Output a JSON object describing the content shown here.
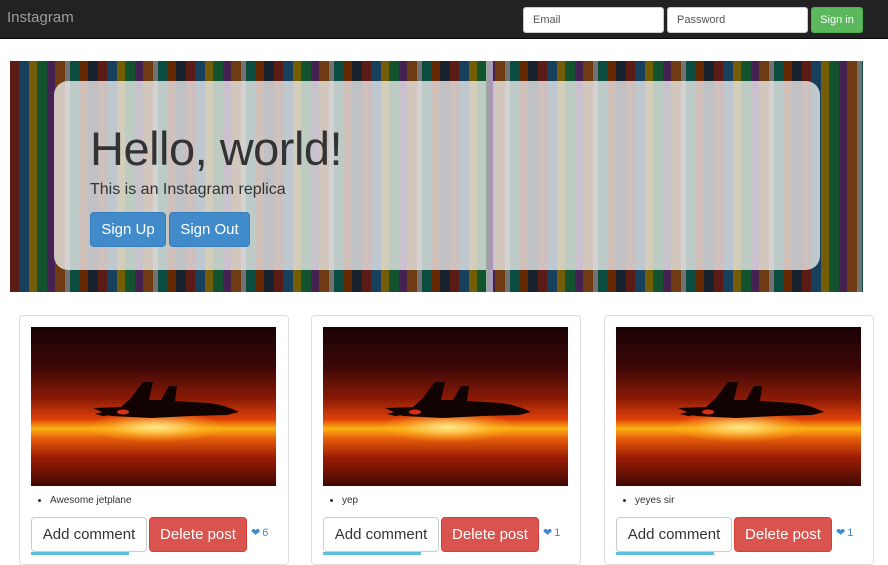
{
  "navbar": {
    "brand": "Instagram",
    "email_placeholder": "Email",
    "password_placeholder": "Password",
    "signin_label": "Sign in"
  },
  "hero": {
    "title": "Hello, world!",
    "subtitle": "This is an Instagram replica",
    "signup_label": "Sign Up",
    "signout_label": "Sign Out"
  },
  "posts": [
    {
      "caption": "Awesome jetplane",
      "add_comment_label": "Add comment",
      "delete_label": "Delete post",
      "likes": "6"
    },
    {
      "caption": "yep",
      "add_comment_label": "Add comment",
      "delete_label": "Delete post",
      "likes": "1"
    },
    {
      "caption": "yeyes sir",
      "add_comment_label": "Add comment",
      "delete_label": "Delete post",
      "likes": "1"
    }
  ],
  "icons": {
    "like": "heart-icon",
    "post_image": "jetplane-sunset-photo"
  },
  "colors": {
    "navbar_bg": "#222222",
    "signin_green": "#5cb85c",
    "primary_blue": "#428bca",
    "danger_red": "#d9534f"
  }
}
